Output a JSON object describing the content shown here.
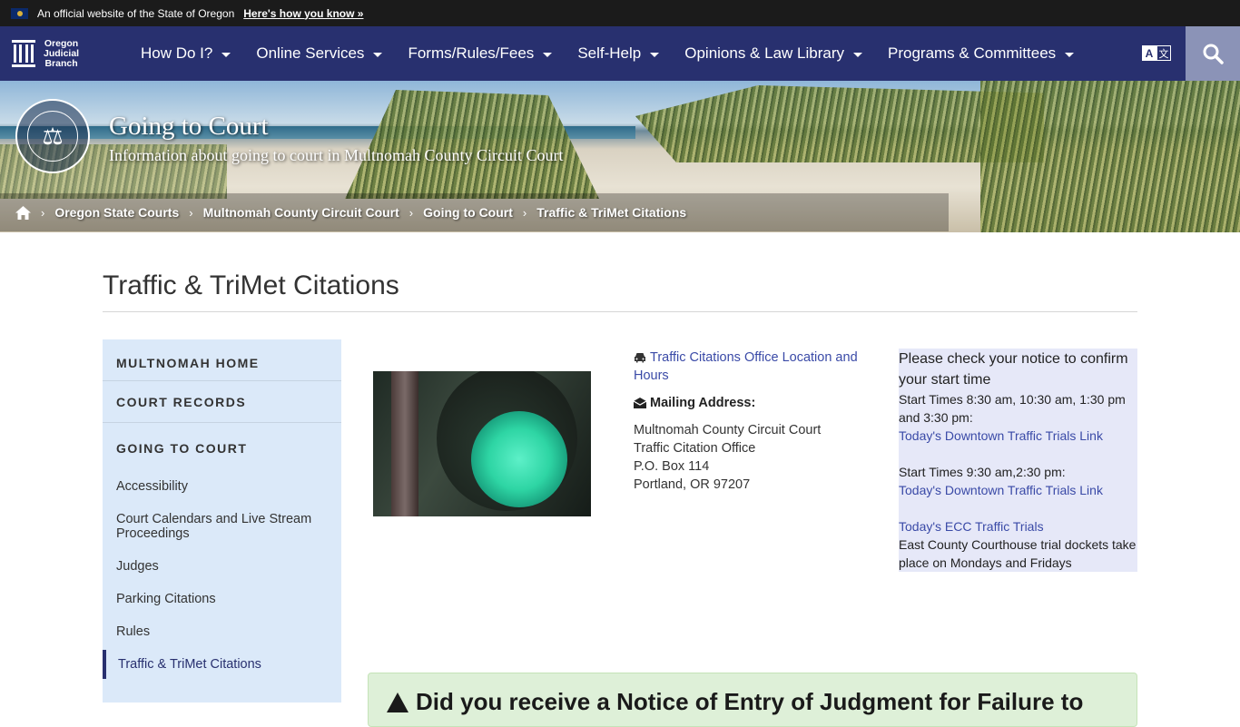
{
  "gov_banner": {
    "text": "An official website of the State of Oregon",
    "link": "Here's how you know »"
  },
  "logo": {
    "line1": "Oregon",
    "line2": "Judicial",
    "line3": "Branch"
  },
  "nav": {
    "items": [
      {
        "label": "How Do I?"
      },
      {
        "label": "Online Services"
      },
      {
        "label": "Forms/Rules/Fees"
      },
      {
        "label": "Self-Help"
      },
      {
        "label": "Opinions & Law Library"
      },
      {
        "label": "Programs & Committees"
      }
    ],
    "translate_a": "A",
    "translate_b": "文"
  },
  "hero": {
    "title": "Going to Court",
    "subtitle": "Information about going to court in Multnomah County Circuit Court",
    "seal_text": "⚖"
  },
  "breadcrumb": [
    "Oregon State Courts",
    "Multnomah County Circuit Court",
    "Going to Court",
    "Traffic & TriMet Citations"
  ],
  "page": {
    "title": "Traffic & TriMet Citations"
  },
  "sidebar": {
    "headings": [
      "MULTNOMAH HOME",
      "COURT RECORDS",
      "GOING TO COURT"
    ],
    "links": [
      "Accessibility",
      "Court Calendars and Live Stream Proceedings",
      "Judges",
      "Parking Citations",
      "Rules",
      "Traffic & TriMet Citations"
    ]
  },
  "address": {
    "office_link": "Traffic Citations Office Location and Hours",
    "mailing_label": "Mailing Address:",
    "line1": "Multnomah County Circuit Court",
    "line2": "Traffic Citation Office",
    "line3": "P.O. Box 114",
    "line4": "Portland, OR 97207"
  },
  "notice": {
    "heading": "Please check your notice to confirm your start time",
    "times1": "Start Times 8:30 am, 10:30 am, 1:30 pm and 3:30 pm:",
    "link1": "Today's Downtown Traffic Trials Link",
    "times2": "Start Times 9:30 am,2:30 pm:",
    "link2": "Today's Downtown Traffic Trials Link",
    "link3": "Today's ECC Traffic Trials",
    "ecc_note": "East County Courthouse trial dockets take place on Mondays and Fridays"
  },
  "alert": {
    "text": "Did you receive a Notice of Entry of Judgment for Failure to"
  }
}
